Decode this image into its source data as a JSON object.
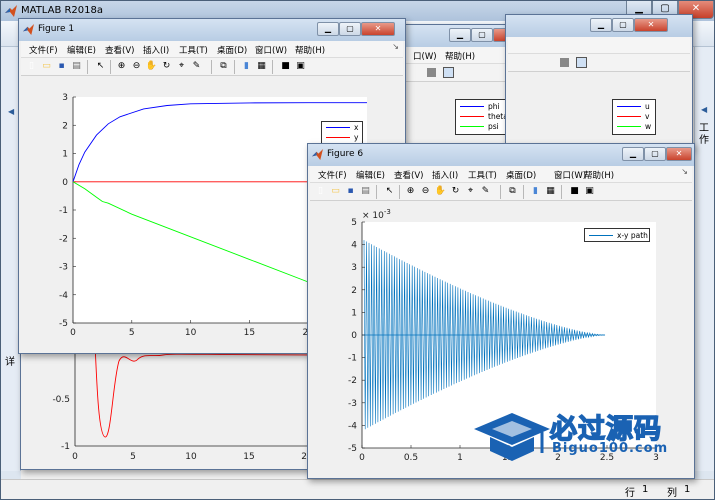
{
  "main": {
    "title": "MATLAB R2018a",
    "min_label": "▁",
    "max_label": "▢",
    "close_label": "✕",
    "right_rail_text": "工作",
    "left_rail_text": "详",
    "status": {
      "row_label": "行",
      "row_value": "1",
      "col_label": "列",
      "col_value": "1"
    }
  },
  "menu_items": [
    "文件(F)",
    "编辑(E)",
    "查看(V)",
    "插入(I)",
    "工具(T)",
    "桌面(D)",
    "窗口(W)",
    "帮助(H)"
  ],
  "menu_items_partial": [
    "口(W)",
    "帮助(H)"
  ],
  "icons": {
    "new": "new-file-icon",
    "open": "open-folder-icon",
    "save": "save-icon",
    "print": "print-icon",
    "pointer": "pointer-icon",
    "zoom_in": "zoom-in-icon",
    "zoom_out": "zoom-out-icon",
    "pan": "pan-hand-icon",
    "rotate": "rotate-3d-icon",
    "datacursor": "data-cursor-icon",
    "brush": "brush-icon",
    "link": "link-plot-icon",
    "colorbar": "colorbar-icon",
    "legend": "legend-icon",
    "hide": "hide-plot-tools-icon",
    "show": "show-plot-tools-icon"
  },
  "figure1": {
    "title": "Figure 1",
    "chart_data": {
      "type": "line",
      "xlim": [
        0,
        25
      ],
      "ylim": [
        -5,
        3
      ],
      "xticks": [
        "0",
        "5",
        "10",
        "15",
        "20"
      ],
      "yticks": [
        "3",
        "2",
        "1",
        "0",
        "-1",
        "-2",
        "-3",
        "-4",
        "-5"
      ],
      "series": [
        {
          "name": "x",
          "color": "#0000ff",
          "x": [
            0,
            0.5,
            1,
            2,
            3,
            4,
            6,
            8,
            10,
            15,
            20,
            25
          ],
          "y": [
            0,
            0.6,
            1.05,
            1.65,
            2.05,
            2.3,
            2.58,
            2.7,
            2.76,
            2.79,
            2.8,
            2.8
          ]
        },
        {
          "name": "y",
          "color": "#ff0000",
          "x": [
            0,
            25
          ],
          "y": [
            0,
            0
          ]
        },
        {
          "name": "z",
          "color": "#00ff00",
          "x": [
            0,
            1,
            2,
            2.5,
            3,
            5,
            10,
            15,
            20,
            25
          ],
          "y": [
            0,
            -0.25,
            -0.55,
            -0.7,
            -0.76,
            -1.15,
            -1.95,
            -2.75,
            -3.55,
            -4.3
          ]
        }
      ]
    }
  },
  "figure_bg1": {
    "chart_data": {
      "type": "line",
      "legend": [
        {
          "name": "phi",
          "color": "#0000ff"
        },
        {
          "name": "theta",
          "color": "#ff0000"
        },
        {
          "name": "psi",
          "color": "#00ff00"
        }
      ]
    }
  },
  "figure_bg2": {
    "chart_data": {
      "type": "line",
      "legend": [
        {
          "name": "u",
          "color": "#0000ff"
        },
        {
          "name": "v",
          "color": "#ff0000"
        },
        {
          "name": "w",
          "color": "#00ff00"
        }
      ]
    }
  },
  "figure_bg3": {
    "chart_data": {
      "type": "line",
      "xticks": [
        "0",
        "5",
        "10",
        "15",
        "20"
      ],
      "yticks": [
        "-0.5",
        "-1"
      ],
      "series": [
        {
          "name": "",
          "color": "#ff0000"
        }
      ]
    }
  },
  "figure6": {
    "title": "Figure 6",
    "chart_data": {
      "type": "line",
      "xlim": [
        0,
        3
      ],
      "ylim": [
        -5,
        5
      ],
      "y_multiplier": "× 10",
      "y_exponent": "-3",
      "xticks": [
        "0",
        "0.5",
        "1",
        "1.5",
        "2",
        "2.5",
        "3"
      ],
      "yticks": [
        "5",
        "4",
        "3",
        "2",
        "1",
        "0",
        "-1",
        "-2",
        "-3",
        "-4",
        "-5"
      ],
      "series": [
        {
          "name": "x-y path",
          "color": "#0072bd",
          "amplitude_start": 4.2,
          "amplitude_end": 0,
          "x_start": 0.02,
          "x_end": 2.48,
          "oscillations": 95
        }
      ]
    }
  },
  "watermark": {
    "chinese": "必过源码",
    "url": "Biguo100.com"
  }
}
